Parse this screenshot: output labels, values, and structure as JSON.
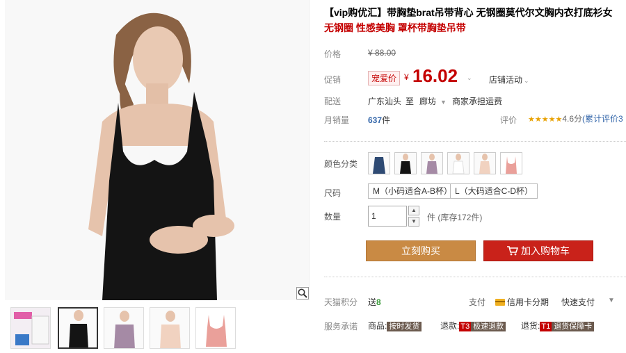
{
  "product": {
    "title": "【vip购优汇】带胸垫brat吊带背心 无钢圈莫代尔文胸内衣打底衫女",
    "subtitle": "无钢圈 性感美胸 罩杯带胸垫吊带"
  },
  "price": {
    "label": "价格",
    "original": "¥ 88.00",
    "promo_label": "促销",
    "promo_badge": "宠爱价",
    "currency": "¥",
    "current": "16.02",
    "shop_activity": "店铺活动"
  },
  "shipping": {
    "label": "配送",
    "from": "广东汕头",
    "to_word": "至",
    "to": "廊坊",
    "fee_note": "商家承担运费"
  },
  "sales": {
    "label": "月销量",
    "count": "637",
    "unit": "件",
    "rating_label": "评价",
    "stars": "★★★★★",
    "score": "4.6分",
    "reviews": "(累计评价3"
  },
  "color": {
    "label": "颜色分类",
    "options": [
      "navy",
      "black",
      "mauve",
      "white",
      "nude",
      "pink"
    ]
  },
  "size": {
    "label": "尺码",
    "options": [
      "M（小码适合A-B杯）",
      "L（大码适合C-D杯）"
    ]
  },
  "quantity": {
    "label": "数量",
    "value": "1",
    "unit": "件",
    "stock": "(库存172件)"
  },
  "actions": {
    "buy": "立刻购买",
    "cart": "加入购物车"
  },
  "points": {
    "label": "天猫积分",
    "give_word": "送",
    "value": "8",
    "pay_label": "支付",
    "credit": "信用卡分期",
    "quick_pay": "快速支付"
  },
  "service": {
    "label": "服务承诺",
    "goods_word": "商品:",
    "goods_tag": "按时发货",
    "refund_word": "退款:",
    "refund_tag_a": "T3",
    "refund_tag_b": "极速退款",
    "return_word": "退货:",
    "return_tag_a": "T1",
    "return_tag_b": "退货保障卡"
  },
  "colors": {
    "price_red": "#c40000",
    "buy_btn": "#c98a44",
    "cart_btn": "#c9221a",
    "link_blue": "#3366aa"
  }
}
